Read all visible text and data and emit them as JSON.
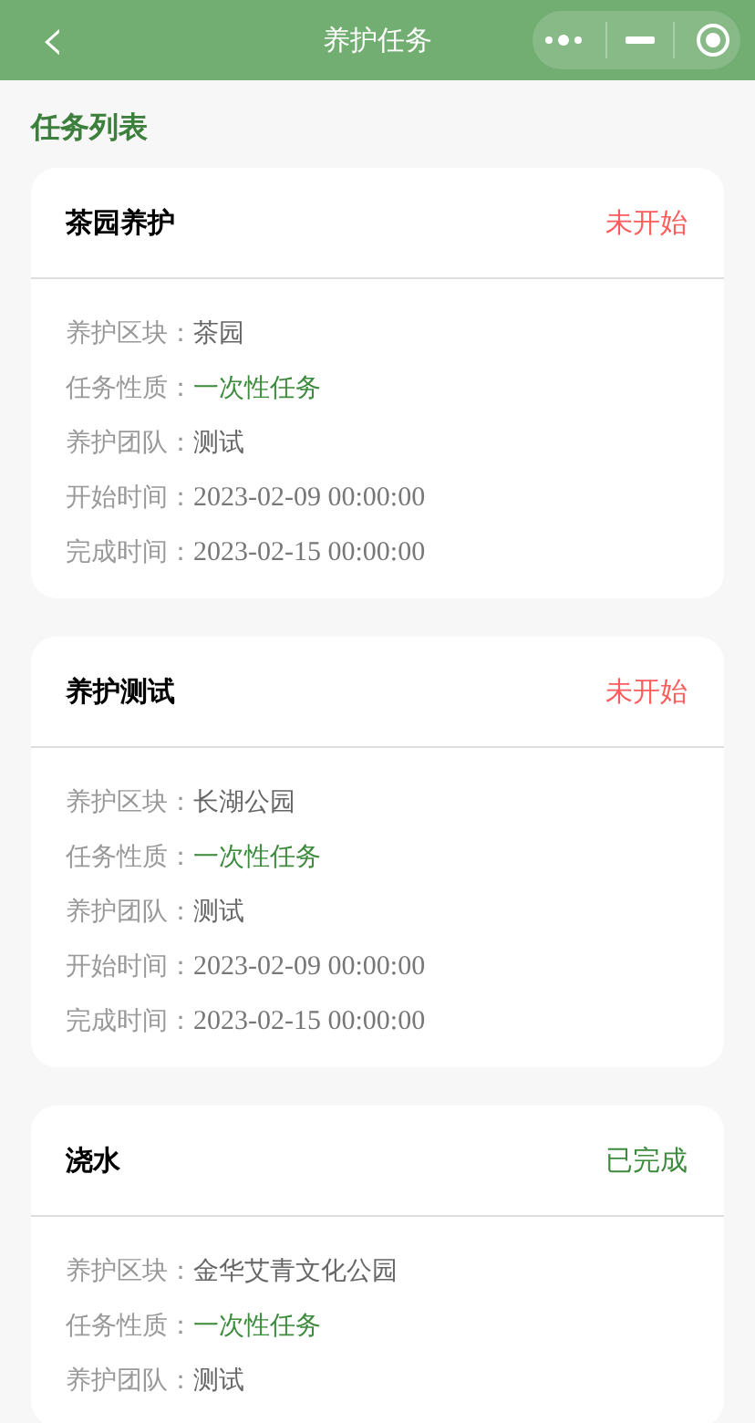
{
  "nav": {
    "back_icon": "‹",
    "title": "养护任务"
  },
  "section_title": "任务列表",
  "tasks": [
    {
      "name": "茶园养护",
      "status": "未开始",
      "color": "#ff5c5c",
      "fields": [
        {
          "label": "养护区块：",
          "value": "茶园",
          "kind": "text"
        },
        {
          "label": "任务性质：",
          "value": "一次性任务",
          "kind": "tag"
        },
        {
          "label": "养护团队：",
          "value": "测试",
          "kind": "text"
        },
        {
          "label": "开始时间：",
          "value": "2023-02-09 00:00:00",
          "kind": "date"
        },
        {
          "label": "完成时间：",
          "value": "2023-02-15 00:00:00",
          "kind": "date"
        }
      ]
    },
    {
      "name": "养护测试",
      "status": "未开始",
      "color": "#ff5c5c",
      "fields": [
        {
          "label": "养护区块：",
          "value": "长湖公园",
          "kind": "text"
        },
        {
          "label": "任务性质：",
          "value": "一次性任务",
          "kind": "tag"
        },
        {
          "label": "养护团队：",
          "value": "测试",
          "kind": "text"
        },
        {
          "label": "开始时间：",
          "value": "2023-02-09 00:00:00",
          "kind": "date"
        },
        {
          "label": "完成时间：",
          "value": "2023-02-15 00:00:00",
          "kind": "date"
        }
      ]
    },
    {
      "name": "浇水",
      "status": "已完成",
      "color": "#3d8b3d",
      "fields": [
        {
          "label": "养护区块：",
          "value": "金华艾青文化公园",
          "kind": "text"
        },
        {
          "label": "任务性质：",
          "value": "一次性任务",
          "kind": "tag"
        },
        {
          "label": "养护团队：",
          "value": "测试",
          "kind": "text"
        }
      ]
    }
  ]
}
